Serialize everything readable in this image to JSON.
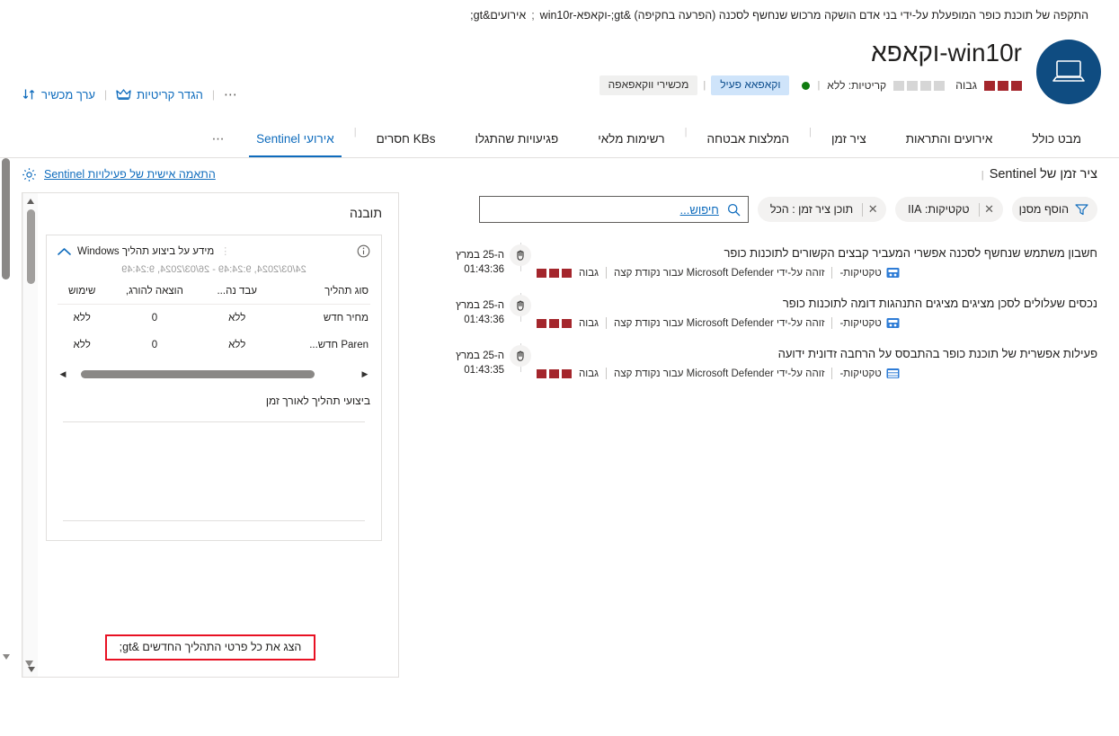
{
  "breadcrumb": {
    "root": "אירועים&gt;",
    "separator": ";",
    "current": "התקפה של תוכנת כופר המופעלת על-ידי בני אדם הושקה מרכוש שנחשף לסכנה (הפרעה בחקיפה) &gt;-וקאפא-win10r"
  },
  "header": {
    "device_title": "וקאפא-win10r",
    "severity_label": "גבוה",
    "criticality_label": "קריטיות: ללא",
    "badges": [
      {
        "label": "וקאפאא פעיל",
        "style": "active"
      },
      {
        "label": "מכשירי ווקאפאפה",
        "style": "muted"
      }
    ],
    "avatar_icon": "laptop-icon",
    "status_dot_color": "#107c10",
    "severity_color": "#a4262c",
    "criticality_color": "#d6d6d6"
  },
  "toolbar": {
    "sort_icon": "sort-arrows-icon",
    "device_value_label": "ערך מכשיר",
    "crown_icon": "crown-icon",
    "set_criticality_label": "הגדר קריטיות",
    "overflow_label": "⋯"
  },
  "tabs": [
    {
      "label": "מבט כולל",
      "active": false
    },
    {
      "label": "אירועים והתראות",
      "active": false
    },
    {
      "label": "ציר זמן",
      "active": false
    },
    {
      "label": "המלצות אבטחה",
      "active": false
    },
    {
      "label": "רשימות מלאי",
      "active": false
    },
    {
      "label": "פגיעויות שהתגלו",
      "active": false
    },
    {
      "label": "KBs חסרים",
      "active": false
    },
    {
      "label": "אירועי Sentinel",
      "active": true
    }
  ],
  "tabs_overflow": "⋯",
  "timeline": {
    "heading": "ציר זמן של Sentinel",
    "search": {
      "placeholder": "חיפוש...",
      "value": "",
      "icon": "search-icon"
    },
    "chips": [
      {
        "label": "תוכן ציר זמן : הכל",
        "closable": true
      },
      {
        "label": "טקטיקות: IIA",
        "closable": true
      }
    ],
    "add_filter": {
      "label": "הוסף מסנן",
      "icon": "filter-icon"
    },
    "items": [
      {
        "date": "ה-25 במרץ",
        "time": "01:43:36",
        "node_icon": "alert-hand-icon",
        "title": "חשבון משתמש שנחשף לסכנה אפשרי המעביר קבצים הקשורים לתוכנות כופר",
        "severity": "גבוה",
        "detected_by": "זוהה על-ידי Microsoft Defender עבור נקודת קצה",
        "tactic": "טקטיקות-",
        "tactic_icon": "shield-badge-icon"
      },
      {
        "date": "ה-25 במרץ",
        "time": "01:43:36",
        "node_icon": "alert-hand-icon",
        "title": "נכסים שעלולים לסכן מציגים מציגים התנהגות דומה לתוכנות כופר",
        "severity": "גבוה",
        "detected_by": "זוהה על-ידי Microsoft Defender עבור נקודת קצה",
        "tactic": "טקטיקות-",
        "tactic_icon": "shield-badge-icon"
      },
      {
        "date": "ה-25 במרץ",
        "time": "01:43:35",
        "node_icon": "alert-hand-icon",
        "title": "פעילות אפשרית של תוכנת כופר בהתבסס על הרחבה זדונית ידועה",
        "severity": "גבוה",
        "detected_by": "זוהה על-ידי Microsoft Defender עבור נקודת קצה",
        "tactic": "טקטיקות-",
        "tactic_icon": "server-rack-icon"
      }
    ]
  },
  "insight": {
    "customize_link": "התאמה אישית של פעילויות Sentinel",
    "gear_icon": "gear-icon",
    "card_title": "תובנה",
    "panel": {
      "chevron_icon": "chevron-up-icon",
      "title": "מידע על ביצוע תהליך Windows",
      "info_icon": "info-icon",
      "date_range": "24/03/2024, 9:24:49 - 26/03/2024, 9:24:49",
      "table": {
        "columns": [
          "סוג תהליך",
          "עבד נה...",
          "הוצאה להורג,",
          "שימוש"
        ],
        "rows": [
          [
            "מחיר חדש",
            "ללא",
            "0",
            "ללא"
          ],
          [
            "Paren חדש...",
            "ללא",
            "0",
            "ללא"
          ]
        ]
      },
      "hscroll": {
        "left_arrow": "◀",
        "right_arrow": "▶"
      }
    },
    "perf_title": "ביצועי תהליך לאורך זמן",
    "show_all_button": "הצג את כל פרטי התהליך החדשים &gt;",
    "show_all_highlight_color": "#e81123"
  }
}
